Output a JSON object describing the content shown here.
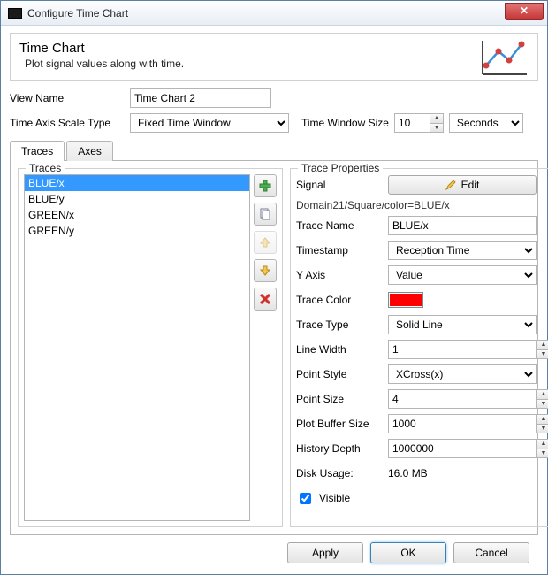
{
  "window": {
    "title": "Configure Time Chart",
    "close": "X"
  },
  "header": {
    "title": "Time Chart",
    "subtitle": "Plot signal values along with time."
  },
  "form": {
    "view_name_label": "View Name",
    "view_name_value": "Time Chart 2",
    "scale_type_label": "Time Axis Scale Type",
    "scale_type_value": "Fixed Time Window",
    "window_size_label": "Time Window Size",
    "window_size_value": "10",
    "window_unit_value": "Seconds"
  },
  "tabs": {
    "traces": "Traces",
    "axes": "Axes"
  },
  "traces": {
    "legend": "Traces",
    "items": [
      "BLUE/x",
      "BLUE/y",
      "GREEN/x",
      "GREEN/y"
    ]
  },
  "props": {
    "legend": "Trace Properties",
    "signal_label": "Signal",
    "edit_label": "Edit",
    "signal_path": "Domain21/Square/color=BLUE/x",
    "trace_name_label": "Trace Name",
    "trace_name_value": "BLUE/x",
    "timestamp_label": "Timestamp",
    "timestamp_value": "Reception Time",
    "yaxis_label": "Y Axis",
    "yaxis_value": "Value",
    "trace_color_label": "Trace Color",
    "trace_color_value": "#ff0000",
    "trace_type_label": "Trace Type",
    "trace_type_value": "Solid Line",
    "line_width_label": "Line Width",
    "line_width_value": "1",
    "point_style_label": "Point Style",
    "point_style_value": "XCross(x)",
    "point_size_label": "Point Size",
    "point_size_value": "4",
    "plot_buffer_label": "Plot Buffer Size",
    "plot_buffer_value": "1000",
    "history_depth_label": "History Depth",
    "history_depth_value": "1000000",
    "disk_usage_label": "Disk Usage:",
    "disk_usage_value": "16.0 MB",
    "visible_label": "Visible"
  },
  "footer": {
    "apply": "Apply",
    "ok": "OK",
    "cancel": "Cancel"
  }
}
